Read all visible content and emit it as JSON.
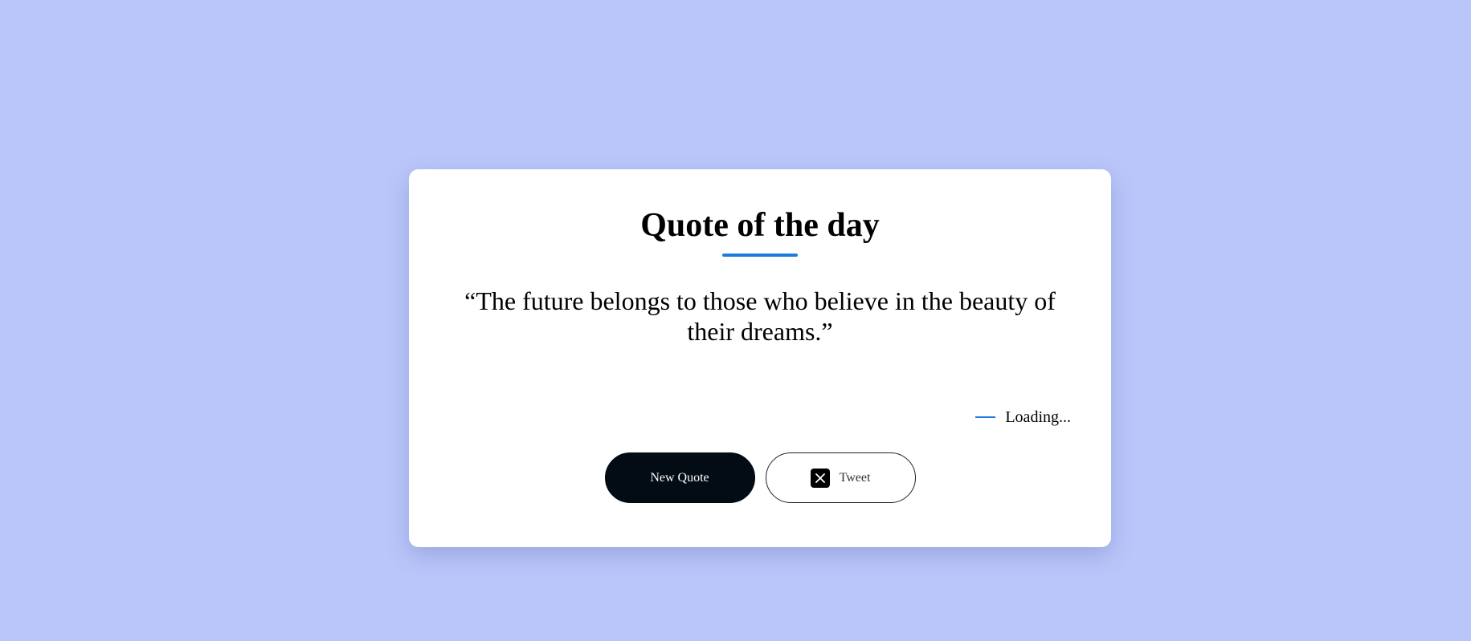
{
  "card": {
    "title": "Quote of the day",
    "quote": "“The future belongs to those who believe in the beauty of their dreams.”",
    "author": "Loading..."
  },
  "buttons": {
    "new_quote_label": "New Quote",
    "tweet_label": "Tweet",
    "tweet_icon": "x-logo-icon"
  },
  "colors": {
    "background": "#bac6f9",
    "accent": "#1f7ae0",
    "primary_button": "#030b14",
    "card": "#ffffff"
  }
}
